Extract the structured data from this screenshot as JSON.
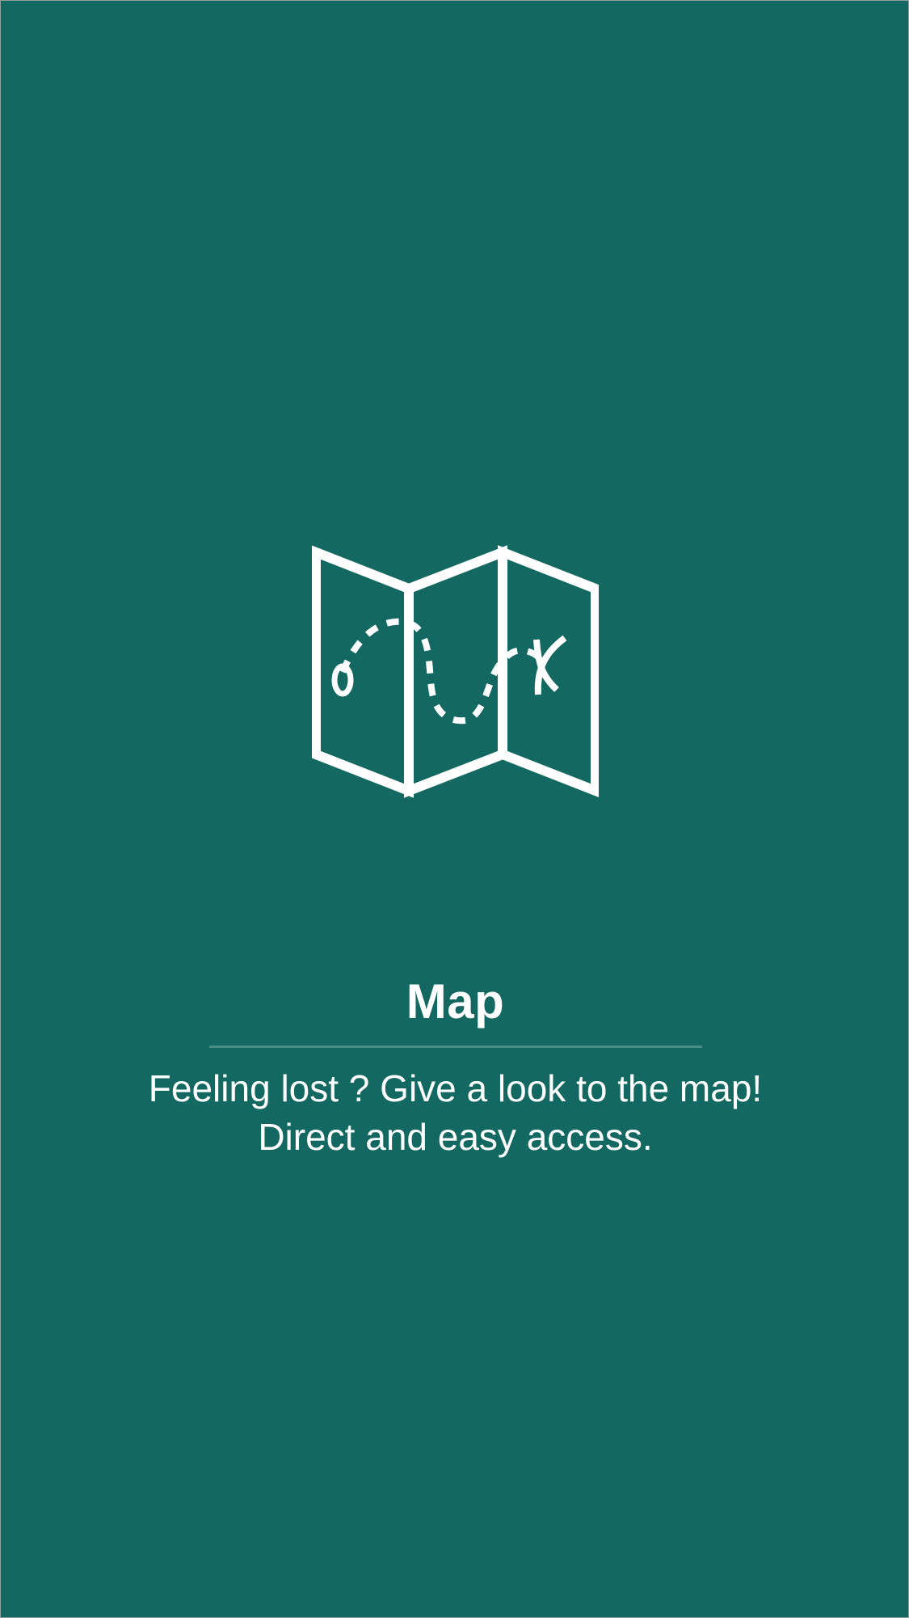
{
  "screen": {
    "background_color": "#146862",
    "illustration_icon": "folded-map-icon",
    "title": "Map",
    "description_lines": [
      "Feeling lost ? Give a look to the map!",
      "Direct and easy access."
    ]
  }
}
